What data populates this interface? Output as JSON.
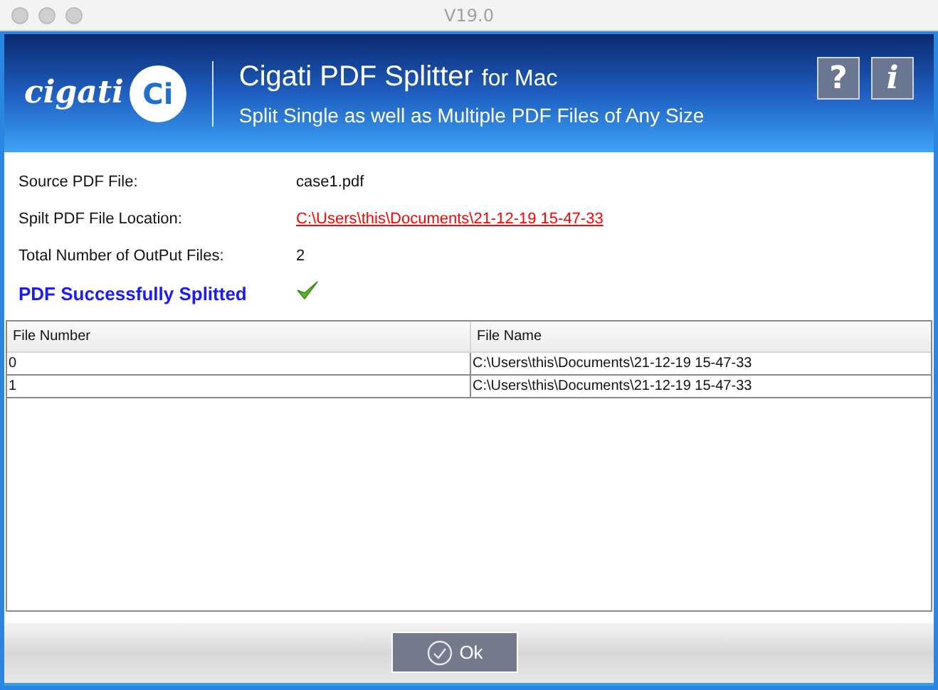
{
  "window": {
    "title": "V19.0"
  },
  "header": {
    "logo_text": "cigati",
    "logo_mark": "Ci",
    "title": "Cigati PDF Splitter",
    "title_suffix": "for Mac",
    "subtitle": "Split Single as well as Multiple PDF Files of Any Size",
    "help_button": "?",
    "info_button": "i"
  },
  "info": [
    {
      "label": "Source PDF File:",
      "value": "case1.pdf",
      "kind": "text"
    },
    {
      "label": "Spilt PDF File Location:",
      "value": "C:\\Users\\this\\Documents\\21-12-19 15-47-33",
      "kind": "link"
    },
    {
      "label": "Total Number of OutPut Files:",
      "value": "2",
      "kind": "text"
    }
  ],
  "status": {
    "message": "PDF Successfully Splitted",
    "success": true
  },
  "table": {
    "columns": [
      "File Number",
      "File Name"
    ],
    "rows": [
      [
        "0",
        "C:\\Users\\this\\Documents\\21-12-19 15-47-33"
      ],
      [
        "1",
        "C:\\Users\\this\\Documents\\21-12-19 15-47-33"
      ]
    ]
  },
  "buttons": [
    "Ok"
  ]
}
